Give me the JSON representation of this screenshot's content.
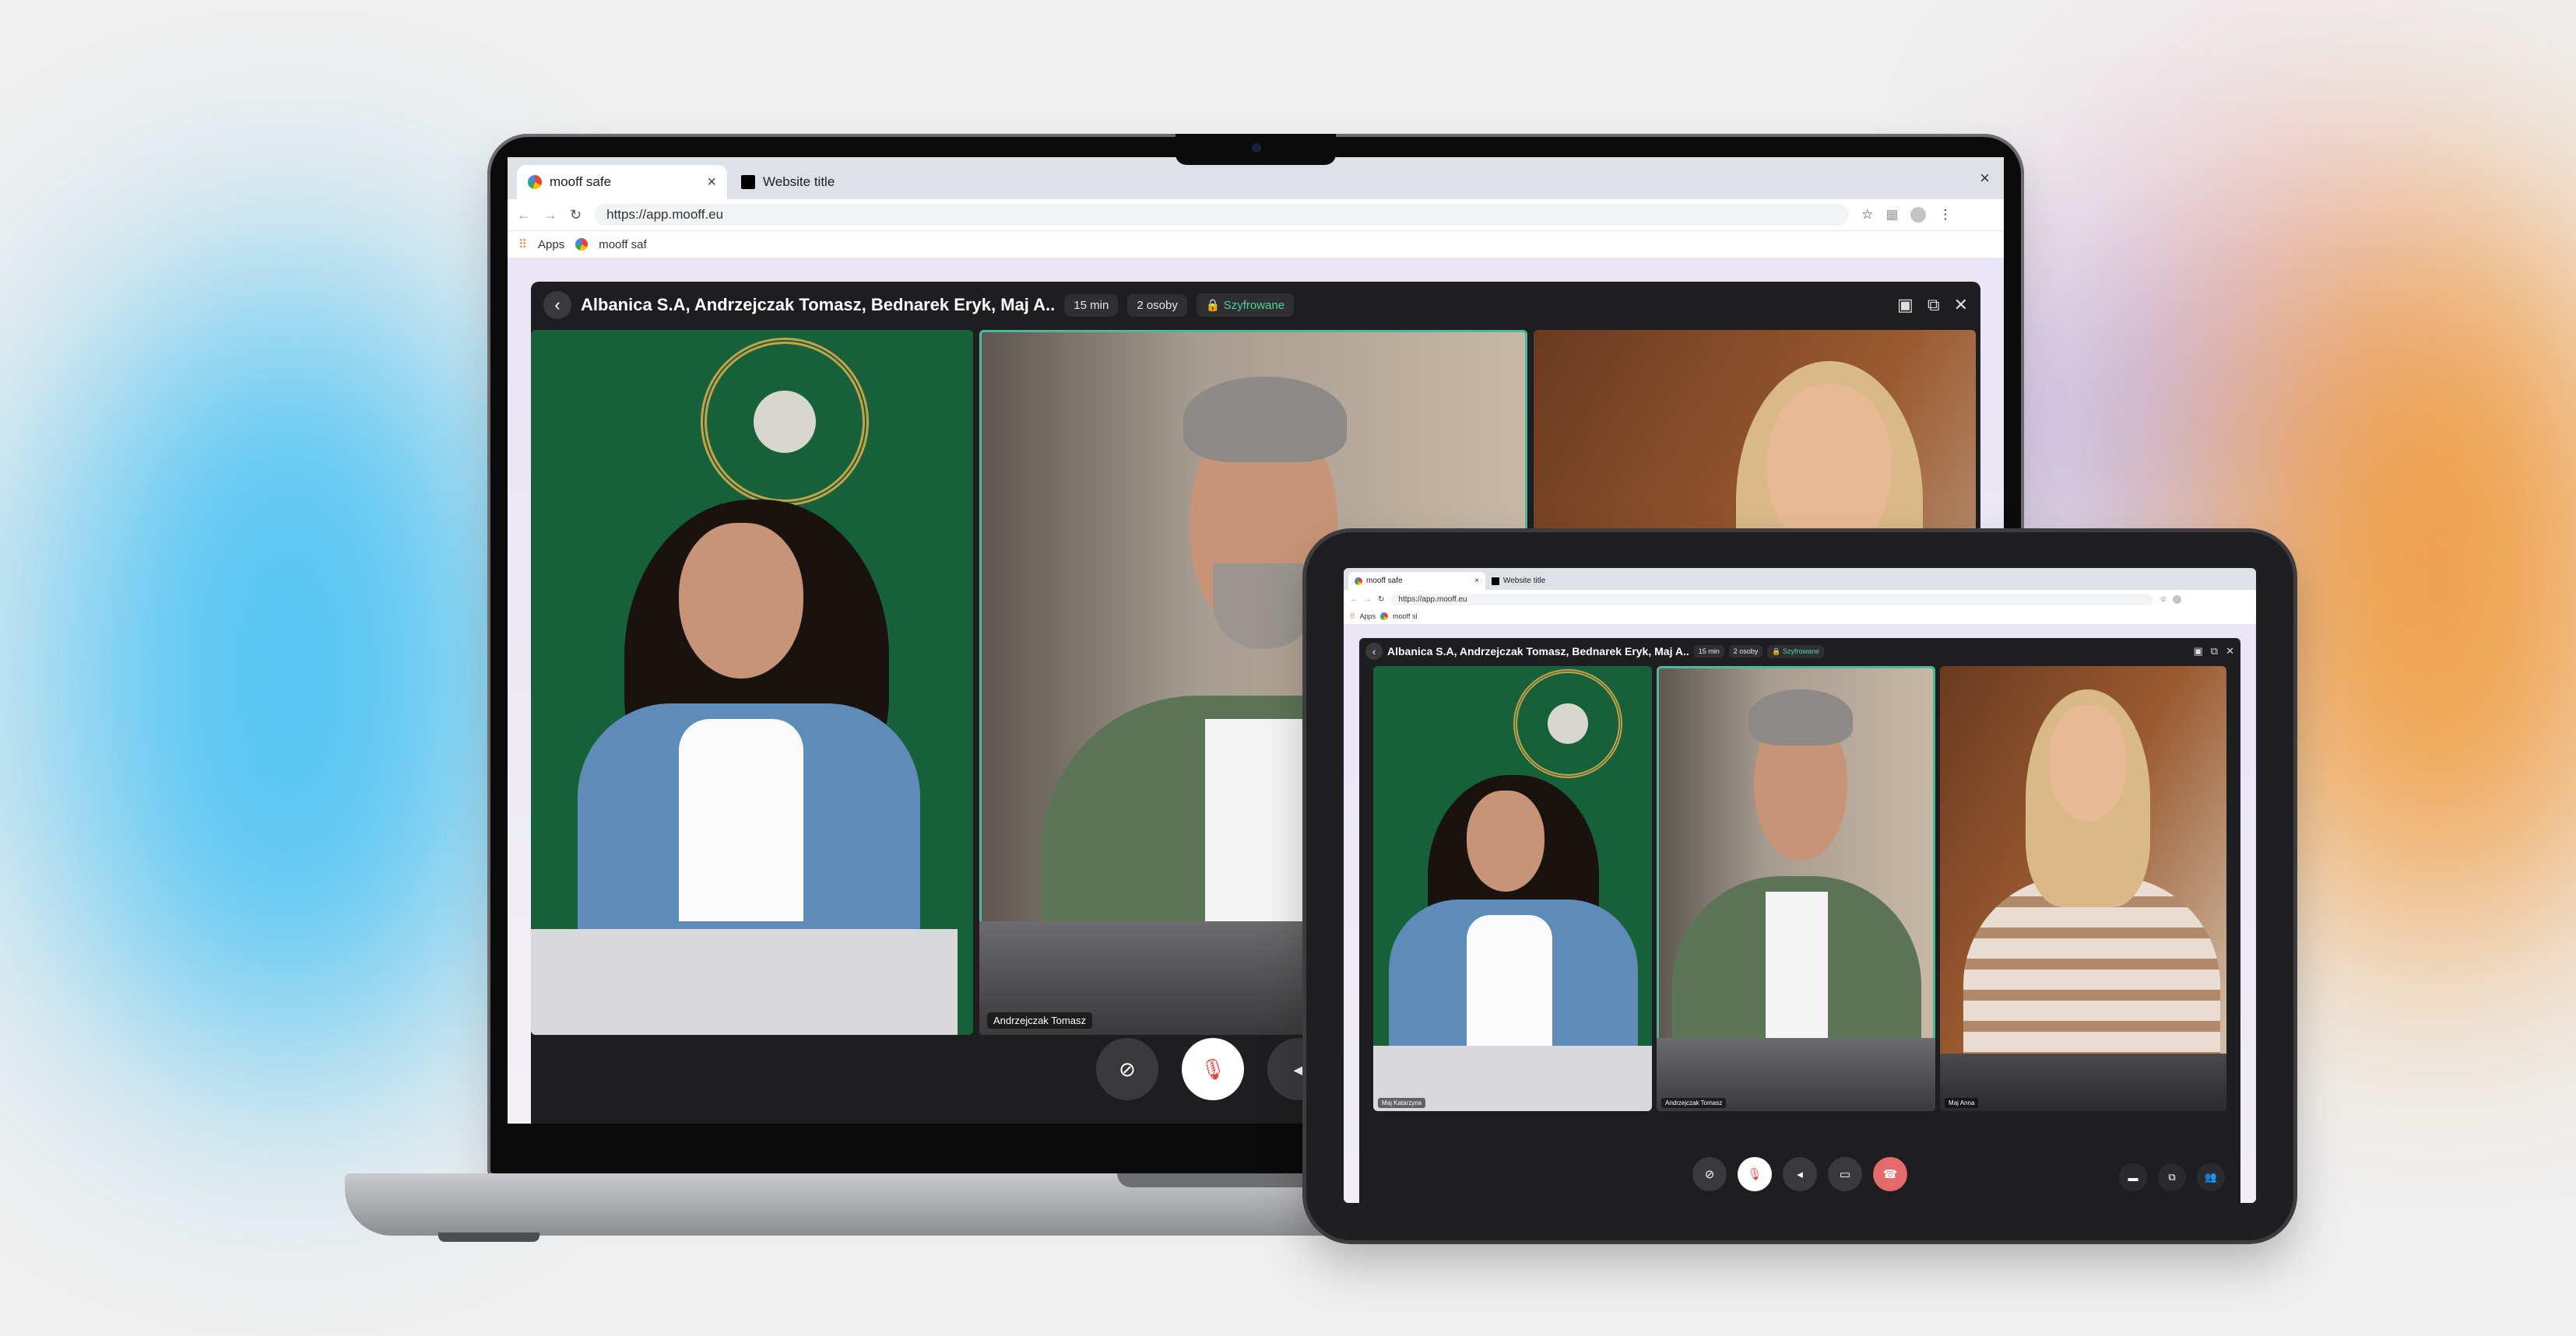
{
  "browser": {
    "active_tab_title": "mooff safe",
    "second_tab_title": "Website title",
    "url": "https://app.mooff.eu",
    "bookmarks": {
      "apps_label": "Apps",
      "bookmark_label": "mooff saf"
    }
  },
  "call": {
    "title": "Albanica S.A, Andrzejczak Tomasz, Bednarek Eryk, Maj A..",
    "duration": "15 min",
    "participants": "2 osoby",
    "encryption": "Szyfrowane",
    "active_speaker": "Andrzejczak Tomasz"
  },
  "tablet": {
    "active_tab_title": "mooff safe",
    "second_tab_title": "Website title",
    "url": "https://app.mooff.eu",
    "bookmarks": {
      "apps_label": "Apps",
      "bookmark_label": "mooff sl"
    },
    "call_title": "Albanica S.A, Andrzejczak Tomasz, Bednarek Eryk, Maj A..",
    "duration": "15 min",
    "participants": "2 osoby",
    "encryption": "Szyfrowane",
    "tile_names": [
      "Maj Katarzyna",
      "Andrzejczak Tomasz",
      "Maj Anna"
    ]
  },
  "icons": {
    "back": "chevron-left-icon",
    "pip": "picture-in-picture-icon",
    "window": "window-icon",
    "close": "close-icon",
    "camera_off": "camera-off-icon",
    "mic": "mic-icon",
    "speaker": "speaker-icon",
    "share": "screen-share-icon",
    "hangup": "hangup-icon",
    "chat": "chat-icon",
    "copy": "copy-icon",
    "people": "people-icon"
  },
  "colors": {
    "accent_green": "#4fb795",
    "encrypted_text": "#4fd19c",
    "mic_red": "#e0463c",
    "hangup": "#e36b6b"
  }
}
